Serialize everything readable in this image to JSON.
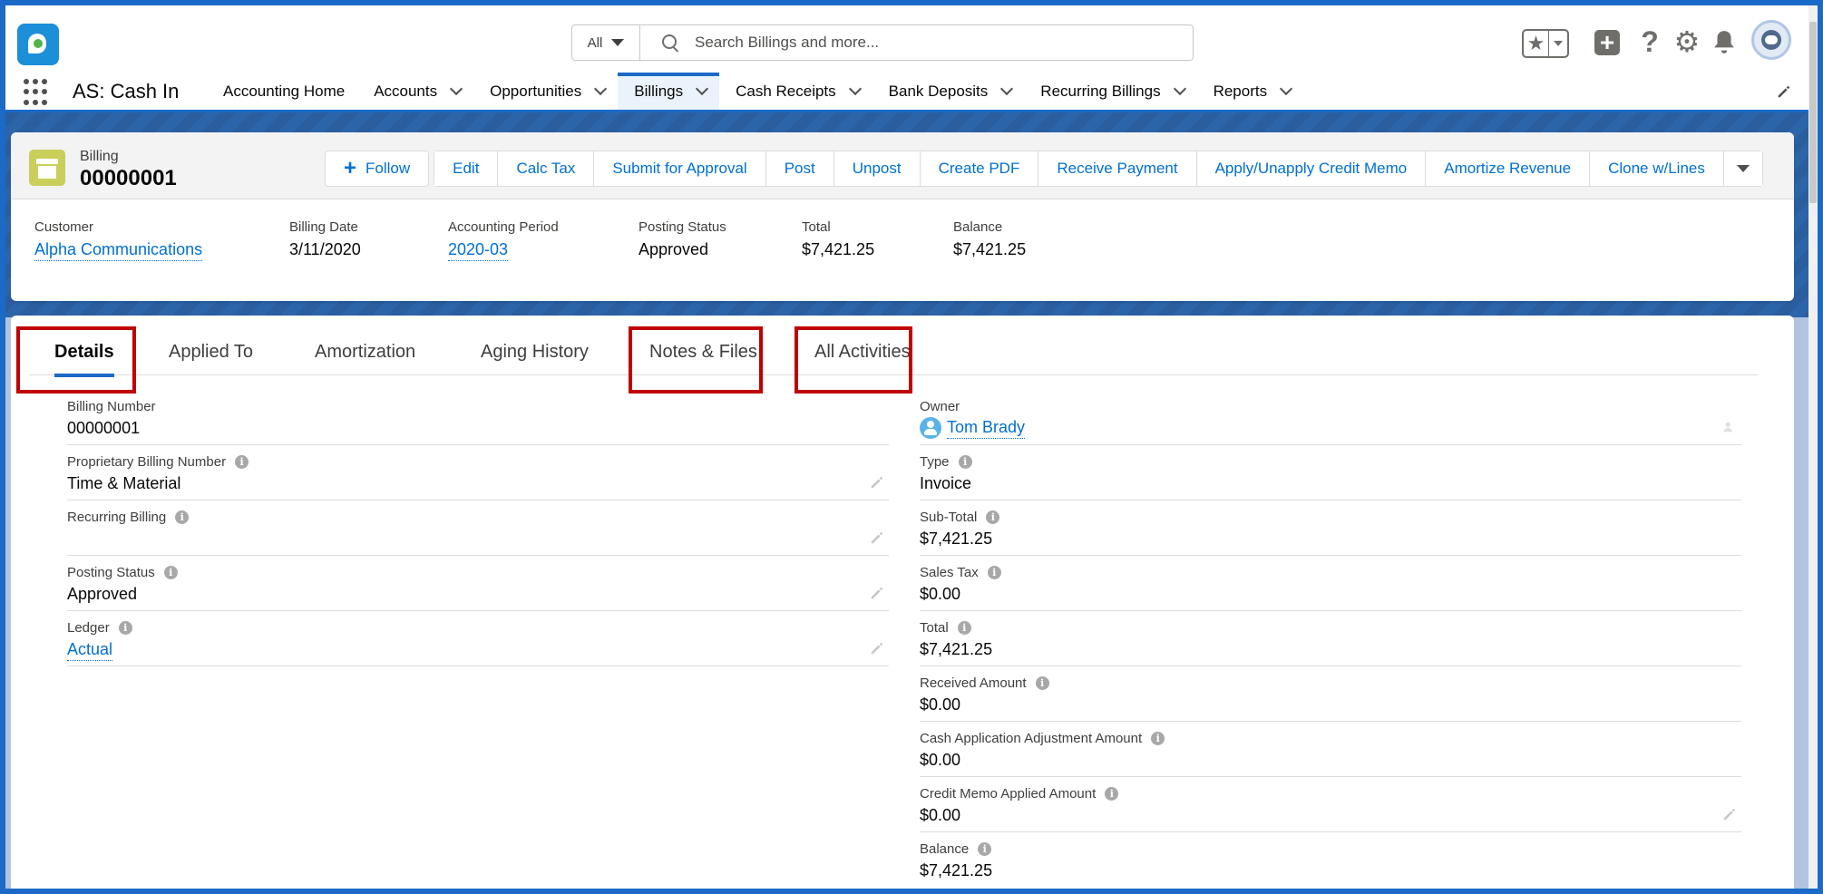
{
  "header": {
    "search_scope": "All",
    "search_placeholder": "Search Billings and more..."
  },
  "nav": {
    "app_name": "AS: Cash In",
    "items": [
      {
        "label": "Accounting Home",
        "has_menu": false
      },
      {
        "label": "Accounts",
        "has_menu": true
      },
      {
        "label": "Opportunities",
        "has_menu": true
      },
      {
        "label": "Billings",
        "has_menu": true,
        "active": true
      },
      {
        "label": "Cash Receipts",
        "has_menu": true
      },
      {
        "label": "Bank Deposits",
        "has_menu": true
      },
      {
        "label": "Recurring Billings",
        "has_menu": true
      },
      {
        "label": "Reports",
        "has_menu": true
      }
    ]
  },
  "record": {
    "object_label": "Billing",
    "title": "00000001",
    "follow_label": "Follow",
    "actions": [
      "Edit",
      "Calc Tax",
      "Submit for Approval",
      "Post",
      "Unpost",
      "Create PDF",
      "Receive Payment",
      "Apply/Unapply Credit Memo",
      "Amortize Revenue",
      "Clone w/Lines"
    ]
  },
  "highlights": [
    {
      "label": "Customer",
      "value": "Alpha Communications",
      "link": true
    },
    {
      "label": "Billing Date",
      "value": "3/11/2020",
      "link": false
    },
    {
      "label": "Accounting Period",
      "value": "2020-03",
      "link": true
    },
    {
      "label": "Posting Status",
      "value": "Approved",
      "link": false
    },
    {
      "label": "Total",
      "value": "$7,421.25",
      "link": false
    },
    {
      "label": "Balance",
      "value": "$7,421.25",
      "link": false
    }
  ],
  "tabs": [
    "Details",
    "Applied To",
    "Amortization",
    "Aging History",
    "Notes & Files",
    "All Activities"
  ],
  "left_fields": [
    {
      "label": "Billing Number",
      "value": "00000001",
      "info": false,
      "editable": false,
      "link": false
    },
    {
      "label": "Proprietary Billing Number",
      "value": "Time & Material",
      "info": true,
      "editable": true,
      "link": false
    },
    {
      "label": "Recurring Billing",
      "value": "",
      "info": true,
      "editable": true,
      "link": false
    },
    {
      "label": "Posting Status",
      "value": "Approved",
      "info": true,
      "editable": true,
      "link": false
    },
    {
      "label": "Ledger",
      "value": "Actual",
      "info": true,
      "editable": true,
      "link": true
    }
  ],
  "right_fields": [
    {
      "label": "Owner",
      "value": "Tom Brady",
      "info": false,
      "editable": false,
      "link": true
    },
    {
      "label": "Type",
      "value": "Invoice",
      "info": true,
      "editable": false,
      "link": false
    },
    {
      "label": "Sub-Total",
      "value": "$7,421.25",
      "info": true,
      "editable": false,
      "link": false
    },
    {
      "label": "Sales Tax",
      "value": "$0.00",
      "info": true,
      "editable": false,
      "link": false
    },
    {
      "label": "Total",
      "value": "$7,421.25",
      "info": true,
      "editable": false,
      "link": false
    },
    {
      "label": "Received Amount",
      "value": "$0.00",
      "info": true,
      "editable": false,
      "link": false
    },
    {
      "label": "Cash Application Adjustment Amount",
      "value": "$0.00",
      "info": true,
      "editable": false,
      "link": false
    },
    {
      "label": "Credit Memo Applied Amount",
      "value": "$0.00",
      "info": true,
      "editable": true,
      "link": false
    },
    {
      "label": "Balance",
      "value": "$7,421.25",
      "info": true,
      "editable": false,
      "link": false
    }
  ],
  "colors": {
    "brand_blue": "#1b6ac7",
    "link_blue": "#0070d2",
    "highlight_red": "#c00000",
    "billing_icon": "#c9cf5a"
  }
}
